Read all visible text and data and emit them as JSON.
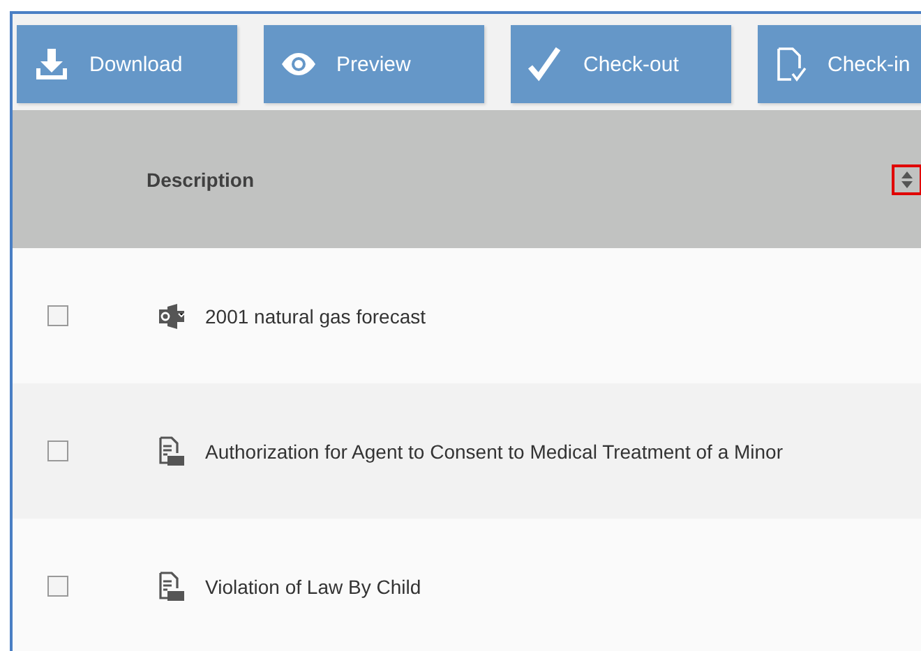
{
  "toolbar": {
    "buttons": [
      {
        "label": "Download"
      },
      {
        "label": "Preview"
      },
      {
        "label": "Check-out"
      },
      {
        "label": "Check-in"
      }
    ]
  },
  "table": {
    "columns": [
      {
        "label": "Description",
        "sort_highlighted": true
      }
    ],
    "rows": [
      {
        "kind": "mail",
        "description": "2001 natural gas forecast",
        "checked": false
      },
      {
        "kind": "pdf",
        "description": "Authorization for Agent to Consent to Medical Treatment of a Minor",
        "checked": false
      },
      {
        "kind": "pdf",
        "description": "Violation of Law By Child",
        "checked": false
      }
    ]
  }
}
